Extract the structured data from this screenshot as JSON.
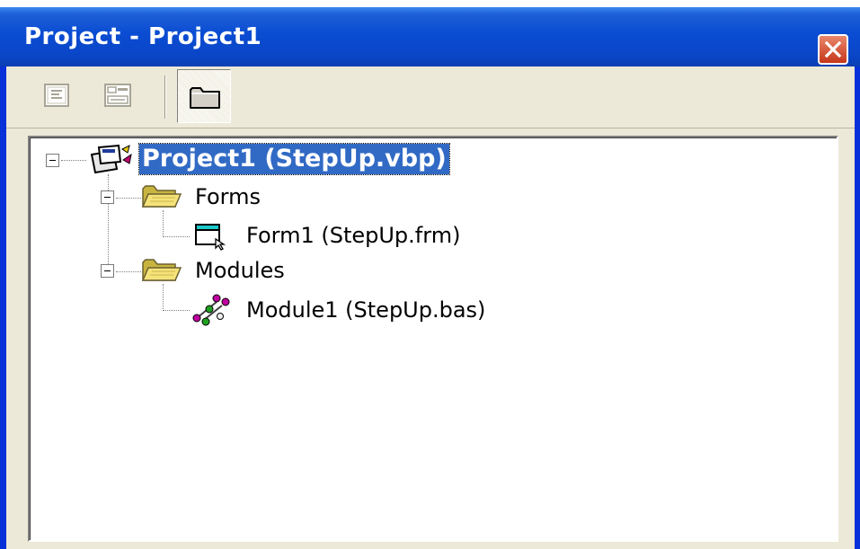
{
  "window": {
    "title": "Project - Project1",
    "close_icon": "close-x-icon",
    "colors": {
      "titlebar": "#0a46c8",
      "selection": "#316ac5",
      "close": "#d2492d"
    }
  },
  "toolbar": {
    "buttons": [
      {
        "label": "View Code",
        "icon": "view-code-icon",
        "pressed": false,
        "enabled": false
      },
      {
        "label": "View Object",
        "icon": "view-object-icon",
        "pressed": false,
        "enabled": false
      },
      {
        "label": "Toggle Folders",
        "icon": "folder-icon",
        "pressed": true,
        "enabled": true
      }
    ]
  },
  "tree": {
    "root": {
      "label": "Project1 (StepUp.vbp)",
      "icon": "project-icon",
      "expanded": true,
      "selected": true,
      "children": [
        {
          "label": "Forms",
          "icon": "open-folder-icon",
          "expanded": true,
          "children": [
            {
              "label": "Form1 (StepUp.frm)",
              "icon": "form-icon"
            }
          ]
        },
        {
          "label": "Modules",
          "icon": "open-folder-icon",
          "expanded": true,
          "children": [
            {
              "label": "Module1 (StepUp.bas)",
              "icon": "module-icon"
            }
          ]
        }
      ]
    }
  }
}
